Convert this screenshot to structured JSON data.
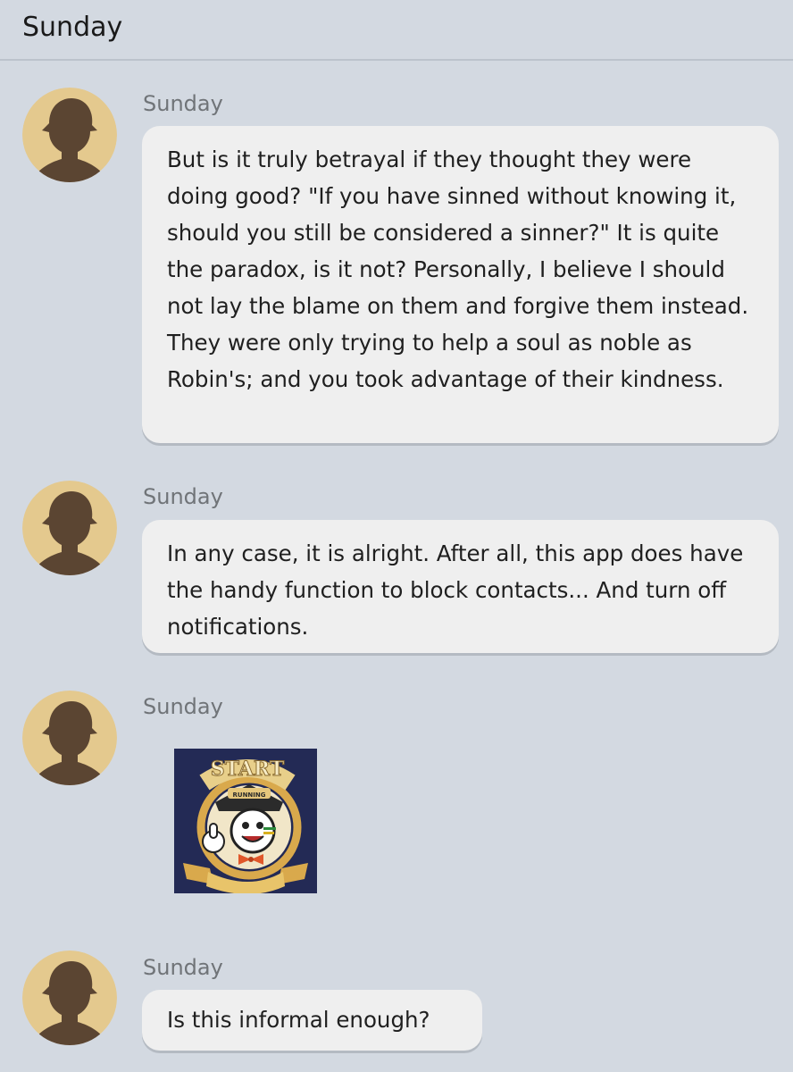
{
  "header": {
    "title": "Sunday"
  },
  "messages": [
    {
      "sender": "Sunday",
      "text": "But is it truly betrayal if they thought they were doing good? \"If you have sinned without knowing it, should you still be considered a sinner?\" It is quite the paradox, is it not? Personally, I believe I should not lay the blame on them and forgive them instead. They were only trying to help a soul as noble as Robin's; and you took advantage of their kindness."
    },
    {
      "sender": "Sunday",
      "text": "In any case, it is alright. After all, this app does have the handy function to block contacts... And turn off notifications."
    },
    {
      "sender": "Sunday",
      "sticker": {
        "banner_text": "START",
        "badge_text": "RUNNING",
        "icon": "clockie-thumbs-up-sticker"
      }
    },
    {
      "sender": "Sunday",
      "text": "Is this informal enough?"
    }
  ],
  "colors": {
    "background": "#d3d9e1",
    "bubble": "#efefef",
    "avatar_bg": "#e4c98e",
    "avatar_silhouette": "#5b4532",
    "sender_text": "#707478"
  }
}
